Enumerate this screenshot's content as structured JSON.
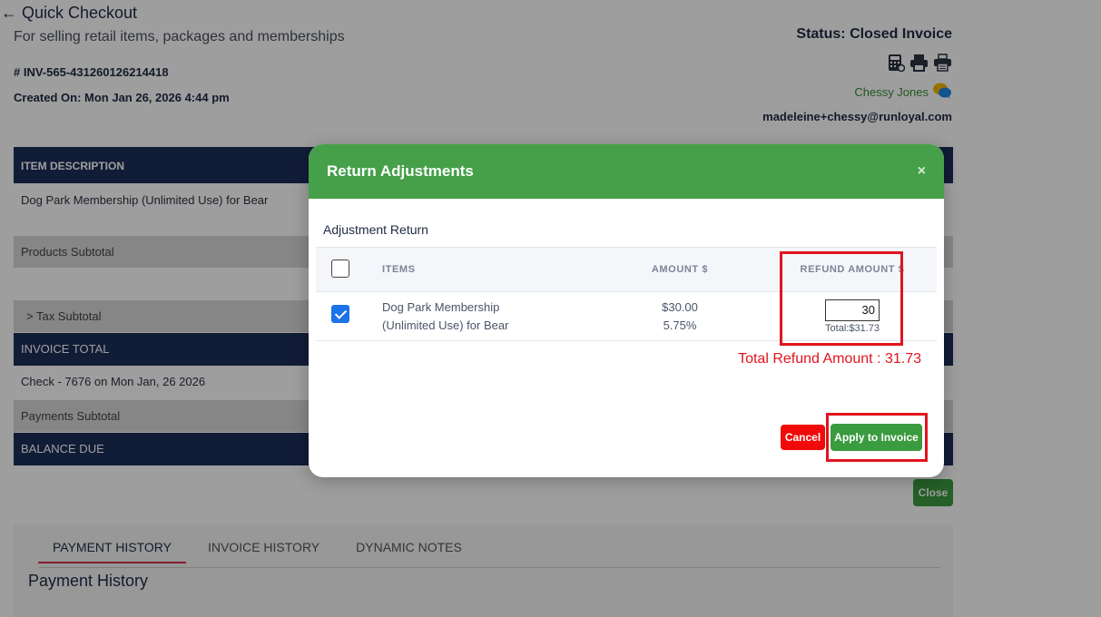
{
  "page": {
    "back_arrow": "←",
    "title": "Quick Checkout",
    "subtitle": "For selling retail items, packages and memberships",
    "invoice_number": "# INV-565-431260126214418",
    "created_on": "Created On: Mon Jan 26, 2026 4:44 pm",
    "status": "Status: Closed Invoice",
    "icons": [
      "calculator-icon",
      "print-icon",
      "receipt-printer-icon"
    ],
    "customer_name": "Chessy Jones",
    "email": "madeleine+chessy@runloyal.com",
    "table_header": "ITEM DESCRIPTION",
    "item_row": "Dog Park Membership (Unlimited Use) for Bear",
    "products_subtotal": "Products Subtotal",
    "tax_subtotal": ">  Tax Subtotal",
    "invoice_total": "INVOICE TOTAL",
    "payment_row": "Check - 7676 on Mon Jan, 26 2026",
    "payments_subtotal": "Payments Subtotal",
    "balance_due": "BALANCE DUE",
    "close_label": "Close",
    "tabs": [
      "PAYMENT HISTORY",
      "INVOICE HISTORY",
      "DYNAMIC NOTES"
    ],
    "active_tab": "PAYMENT HISTORY",
    "payment_history_title": "Payment History"
  },
  "modal": {
    "title": "Return Adjustments",
    "close_symbol": "×",
    "section_label": "Adjustment Return",
    "columns": {
      "items": "ITEMS",
      "amount": "AMOUNT $",
      "refund": "REFUND AMOUNT $"
    },
    "select_all_checked": false,
    "rows": [
      {
        "checked": true,
        "item_line1": "Dog Park Membership",
        "item_line2": "(Unlimited Use) for Bear",
        "amount": "$30.00",
        "tax": "5.75%",
        "refund_value": "30",
        "refund_total": "Total:$31.73"
      }
    ],
    "total_refund": "Total Refund Amount : 31.73",
    "cancel_label": "Cancel",
    "apply_label": "Apply to Invoice"
  },
  "colors": {
    "header_green": "#45a049",
    "navy": "#1c2e5a",
    "highlight_red": "#e0141e",
    "cancel_red": "#f00a0a",
    "checkbox_blue": "#1a73e8"
  }
}
